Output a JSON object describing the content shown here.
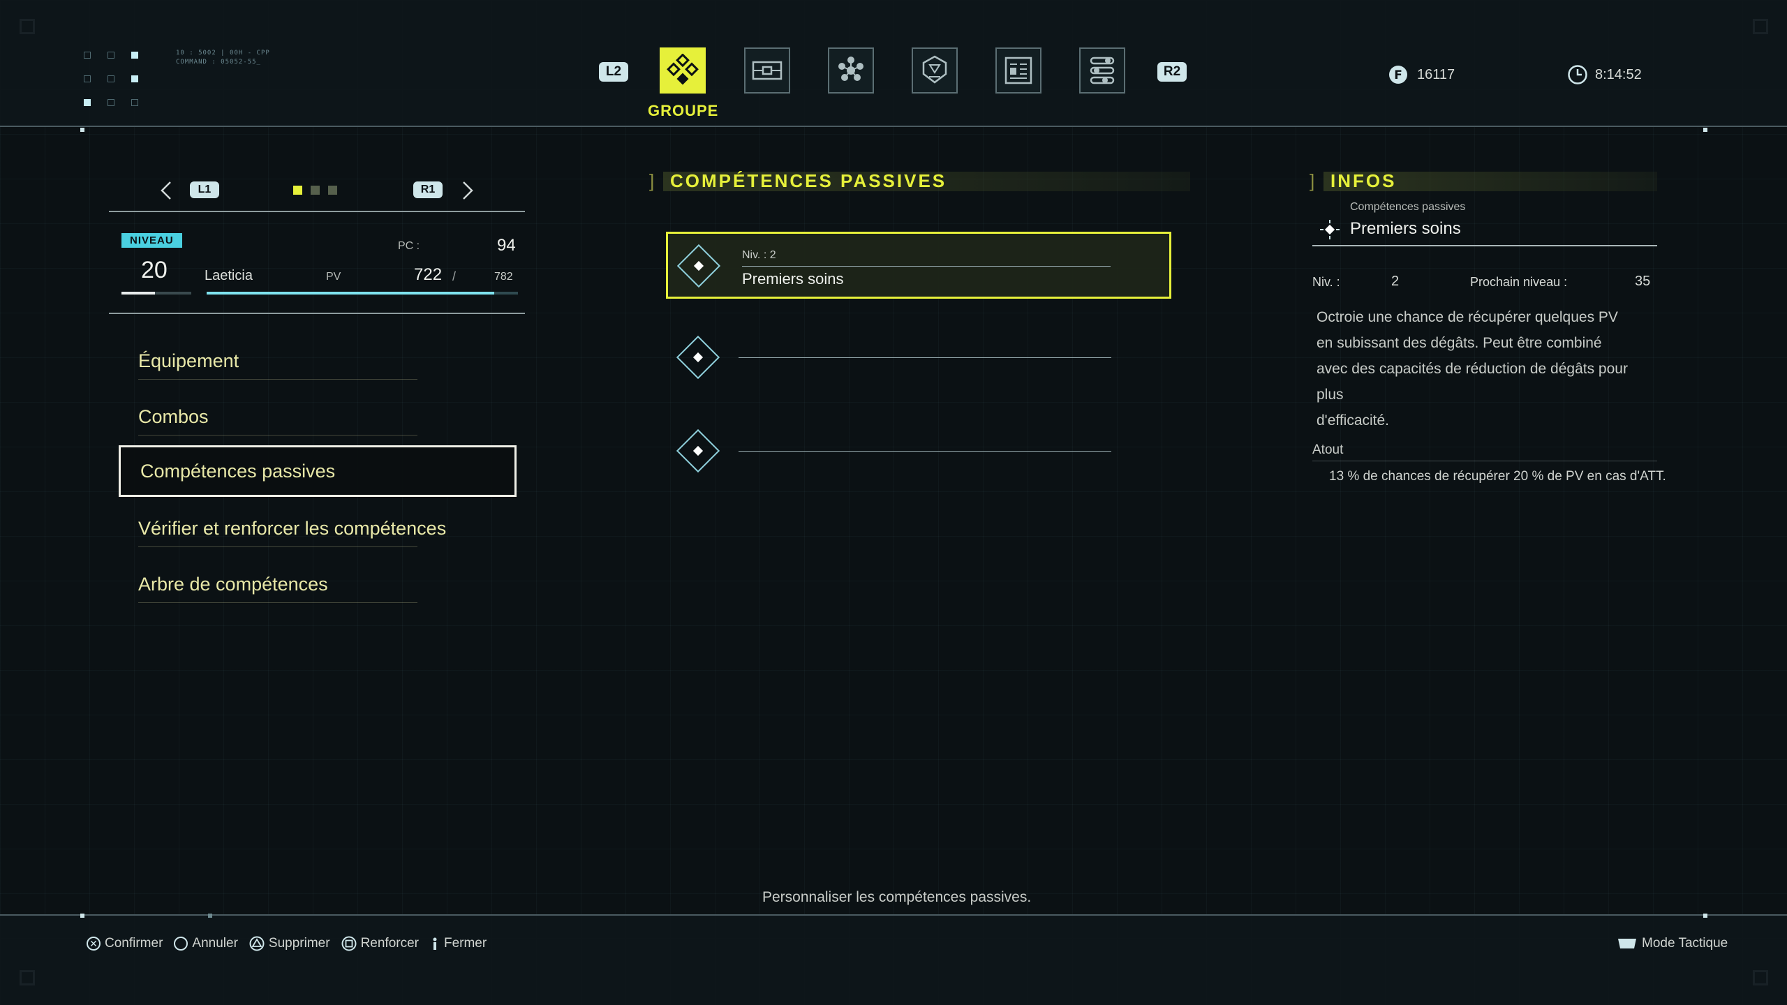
{
  "system": {
    "line1": "10 : 5002 | 00H - CPP",
    "line2": "COMMAND : 05052-55_"
  },
  "nav": {
    "l2": "L2",
    "r2": "R2",
    "active_tab_label": "GROUPE",
    "tabs": [
      "party-icon",
      "equipment-icon",
      "materia-icon",
      "item-icon",
      "report-icon",
      "settings-icon"
    ]
  },
  "status": {
    "currency": "16117",
    "playtime": "8:14:52"
  },
  "character": {
    "l1": "L1",
    "r1": "R1",
    "niveau_label": "NIVEAU",
    "level": "20",
    "name": "Laeticia",
    "pc_label": "PC :",
    "pc_value": "94",
    "pv_label": "PV",
    "pv_current": "722",
    "pv_sep": "/",
    "pv_max": "782",
    "pv_fraction": 0.923
  },
  "menu": {
    "items": [
      "Équipement",
      "Combos",
      "Compétences passives",
      "Vérifier et renforcer les compétences",
      "Arbre de compétences"
    ],
    "selected_index": 2
  },
  "passives": {
    "title": "COMPÉTENCES PASSIVES",
    "slot1_level": "Niv. : 2",
    "slot1_name": "Premiers soins"
  },
  "infos": {
    "title": "INFOS",
    "category": "Compétences passives",
    "name": "Premiers soins",
    "niv_label": "Niv. :",
    "niv_value": "2",
    "next_label": "Prochain niveau :",
    "next_value": "35",
    "desc_lines": [
      "Octroie une chance de récupérer quelques PV",
      "en subissant des dégâts. Peut être combiné",
      "avec des capacités de réduction de dégâts pour plus",
      "d'efficacité."
    ],
    "atout_label": "Atout",
    "atout_text": "13 % de chances de récupérer 20 % de PV en cas d'ATT."
  },
  "footer": {
    "help": "Personnaliser les compétences passives.",
    "confirm": "Confirmer",
    "cancel": "Annuler",
    "delete": "Supprimer",
    "reinforce": "Renforcer",
    "close": "Fermer",
    "tactical": "Mode Tactique"
  },
  "colors": {
    "accent": "#e6f03a",
    "cyan": "#4ad0e0",
    "background": "#0b1114"
  }
}
